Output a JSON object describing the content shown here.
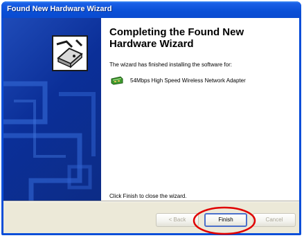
{
  "window": {
    "title": "Found New Hardware Wizard"
  },
  "banner": {
    "icon": "hardware-wizard-icon"
  },
  "main": {
    "heading": "Completing the Found New Hardware Wizard",
    "intro": "The wizard has finished installing the software for:",
    "device_icon": "network-adapter-icon",
    "device_name": "54Mbps High Speed Wireless Network Adapter",
    "finish_note": "Click Finish to close the wizard."
  },
  "buttons": {
    "back": "< Back",
    "finish": "Finish",
    "cancel": "Cancel"
  },
  "annotation": {
    "color": "#e00000"
  }
}
